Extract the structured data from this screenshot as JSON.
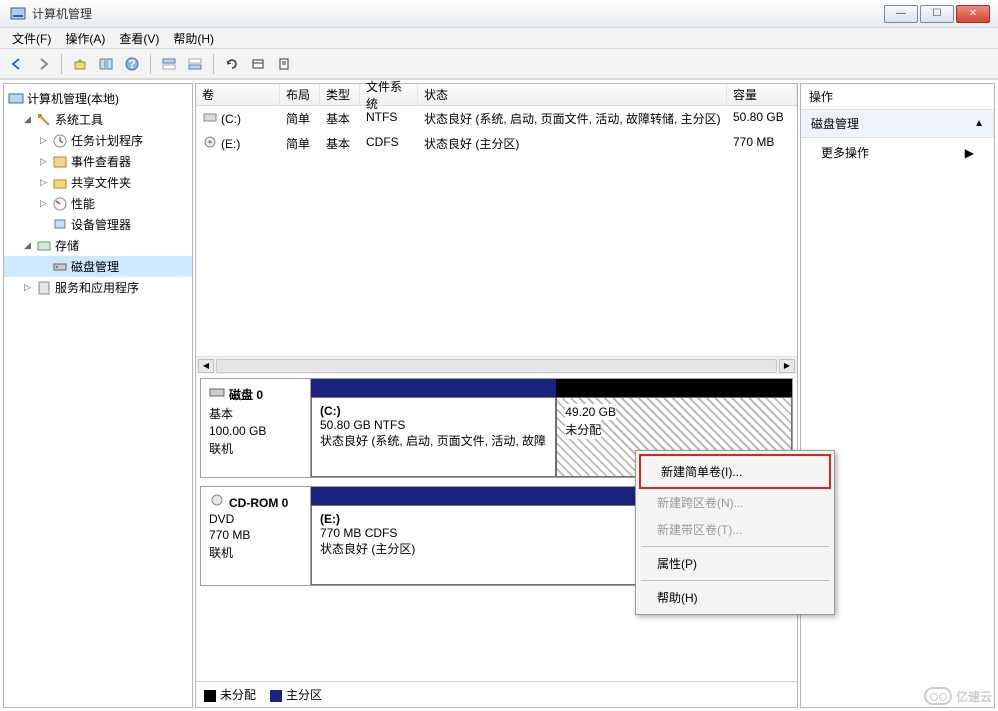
{
  "window": {
    "title": "计算机管理"
  },
  "menu": {
    "file": "文件(F)",
    "action": "操作(A)",
    "view": "查看(V)",
    "help": "帮助(H)"
  },
  "tree": {
    "root": "计算机管理(本地)",
    "system_tools": "系统工具",
    "task_scheduler": "任务计划程序",
    "event_viewer": "事件查看器",
    "shared_folders": "共享文件夹",
    "performance": "性能",
    "device_manager": "设备管理器",
    "storage": "存储",
    "disk_management": "磁盘管理",
    "services_apps": "服务和应用程序"
  },
  "vol_headers": {
    "volume": "卷",
    "layout": "布局",
    "type": "类型",
    "fs": "文件系统",
    "status": "状态",
    "capacity": "容量"
  },
  "volumes": [
    {
      "name": "(C:)",
      "layout": "简单",
      "type": "基本",
      "fs": "NTFS",
      "status": "状态良好 (系统, 启动, 页面文件, 活动, 故障转储, 主分区)",
      "capacity": "50.80 GB"
    },
    {
      "name": "(E:)",
      "layout": "简单",
      "type": "基本",
      "fs": "CDFS",
      "status": "状态良好 (主分区)",
      "capacity": "770 MB"
    }
  ],
  "disks": {
    "disk0": {
      "name": "磁盘 0",
      "type": "基本",
      "size": "100.00 GB",
      "status": "联机",
      "part_c": {
        "label": "(C:)",
        "size": "50.80 GB NTFS",
        "status": "状态良好 (系统, 启动, 页面文件, 活动, 故障"
      },
      "unalloc": {
        "size": "49.20 GB",
        "label": "未分配"
      }
    },
    "cdrom0": {
      "name": "CD-ROM 0",
      "type": "DVD",
      "size": "770 MB",
      "status": "联机",
      "part_e": {
        "label": "(E:)",
        "size": "770 MB CDFS",
        "status": "状态良好 (主分区)"
      }
    }
  },
  "legend": {
    "unalloc": "未分配",
    "primary": "主分区"
  },
  "actions": {
    "header": "操作",
    "sub": "磁盘管理",
    "more": "更多操作"
  },
  "ctx": {
    "new_simple": "新建简单卷(I)...",
    "new_span": "新建跨区卷(N)...",
    "new_stripe": "新建带区卷(T)...",
    "properties": "属性(P)",
    "help": "帮助(H)"
  },
  "watermark": "亿速云"
}
